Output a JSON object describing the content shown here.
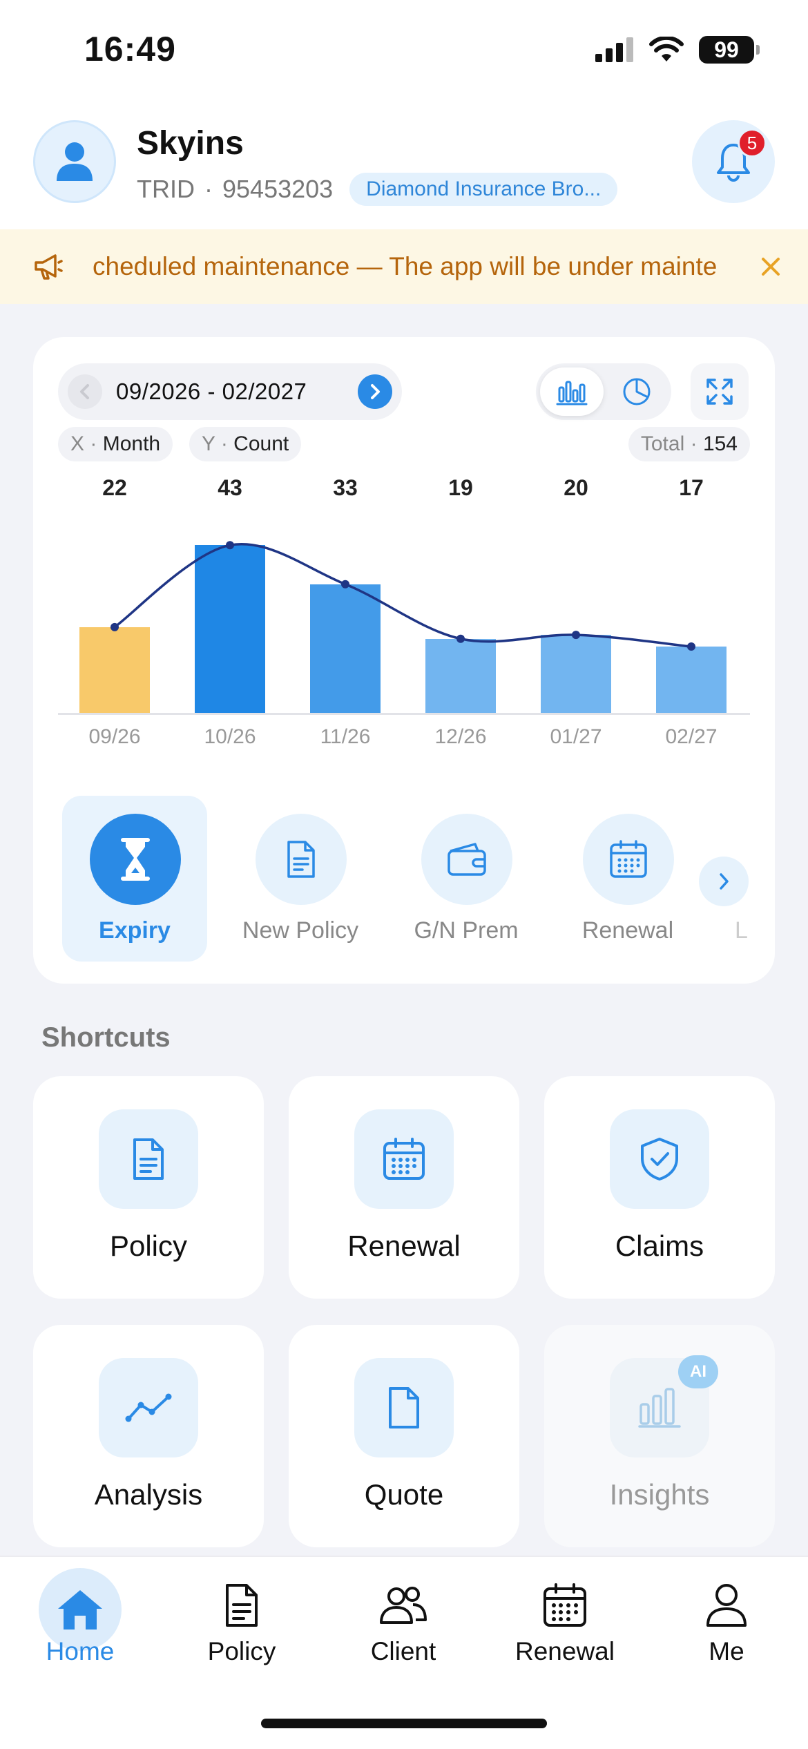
{
  "status_bar": {
    "time": "16:49",
    "battery": "99"
  },
  "header": {
    "name": "Skyins",
    "trid_label": "TRID",
    "separator": "·",
    "trid": "95453203",
    "company": "Diamond Insurance Bro...",
    "notification_count": "5"
  },
  "banner": {
    "text": "cheduled maintenance — The app will be under mainte"
  },
  "chart_card": {
    "date_range": "09/2026 - 02/2027",
    "x_axis_key": "X",
    "x_axis_value": "Month",
    "y_axis_key": "Y",
    "y_axis_value": "Count",
    "total_key": "Total",
    "total_value": "154",
    "separator": "·"
  },
  "chart_data": {
    "type": "bar",
    "categories": [
      "09/26",
      "10/26",
      "11/26",
      "12/26",
      "01/27",
      "02/27"
    ],
    "values": [
      22,
      43,
      33,
      19,
      20,
      17
    ],
    "value_labels": [
      "22",
      "43",
      "33",
      "19",
      "20",
      "17"
    ],
    "xlabel": "Month",
    "ylabel": "Count",
    "ylim": [
      0,
      45
    ],
    "bar_colors": [
      "#f8c96a",
      "#1f87e5",
      "#439be9",
      "#72b5f0",
      "#72b5f0",
      "#72b5f0"
    ],
    "trend_line_color": "#1f3585",
    "grid": false,
    "overlay": "smoothed line through bar values"
  },
  "metric_tabs": [
    {
      "label": "Expiry",
      "icon": "hourglass-icon",
      "active": true
    },
    {
      "label": "New Policy",
      "icon": "document-icon",
      "active": false
    },
    {
      "label": "G/N Prem",
      "icon": "wallet-icon",
      "active": false
    },
    {
      "label": "Renewal",
      "icon": "calendar-icon",
      "active": false
    }
  ],
  "metric_partial": "L",
  "shortcuts": {
    "title": "Shortcuts",
    "items": [
      {
        "label": "Policy",
        "icon": "document-icon"
      },
      {
        "label": "Renewal",
        "icon": "calendar-icon"
      },
      {
        "label": "Claims",
        "icon": "shield-check-icon"
      },
      {
        "label": "Analysis",
        "icon": "trend-line-icon"
      },
      {
        "label": "Quote",
        "icon": "file-icon"
      },
      {
        "label": "Insights",
        "icon": "bar-chart-icon",
        "badge": "AI",
        "disabled": true
      }
    ]
  },
  "tab_bar": [
    {
      "label": "Home",
      "icon": "home-icon",
      "active": true
    },
    {
      "label": "Policy",
      "icon": "document-icon",
      "active": false
    },
    {
      "label": "Client",
      "icon": "users-icon",
      "active": false
    },
    {
      "label": "Renewal",
      "icon": "calendar-icon",
      "active": false
    },
    {
      "label": "Me",
      "icon": "person-icon",
      "active": false
    }
  ],
  "colors": {
    "accent": "#2a8ae5",
    "banner_bg": "#fdf7e4",
    "banner_text": "#b5650c",
    "badge": "#e01f2b",
    "page_bg": "#f2f3f8"
  }
}
